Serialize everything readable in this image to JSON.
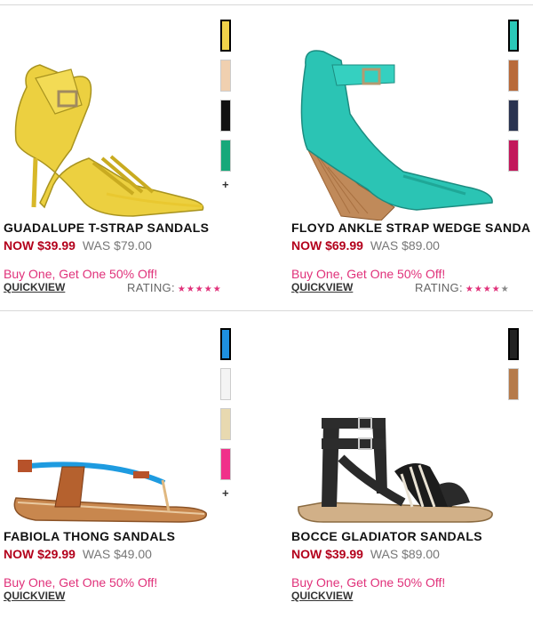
{
  "colors": {
    "price_now": "#b3001b",
    "promo": "#e0317a"
  },
  "products": [
    {
      "name": "GUADALUPE T-STRAP SANDALS",
      "price_now": "NOW $39.99",
      "price_was": "WAS $79.00",
      "promo": "Buy One, Get One 50% Off!",
      "quickview": "QUICKVIEW",
      "rating_label": "RATING:",
      "rating_stars": 5,
      "swatches": [
        "#f0d24a",
        "#f0d0b0",
        "#111111",
        "#17a87a"
      ],
      "more": "+"
    },
    {
      "name": "FLOYD ANKLE STRAP WEDGE SANDA",
      "price_now": "NOW $69.99",
      "price_was": "WAS $89.00",
      "promo": "Buy One, Get One 50% Off!",
      "quickview": "QUICKVIEW",
      "rating_label": "RATING:",
      "rating_stars": 4,
      "swatches": [
        "#2bc9b8",
        "#b86a3a",
        "#2a3350",
        "#c2185b"
      ]
    },
    {
      "name": "FABIOLA THONG SANDALS",
      "price_now": "NOW $29.99",
      "price_was": "WAS $49.00",
      "promo": "Buy One, Get One 50% Off!",
      "quickview": "QUICKVIEW",
      "swatches": [
        "#1e90e0",
        "#f4f4f4",
        "#e8d9b0",
        "#f0308a"
      ],
      "more": "+"
    },
    {
      "name": "BOCCE GLADIATOR SANDALS",
      "price_now": "NOW $39.99",
      "price_was": "WAS $89.00",
      "promo": "Buy One, Get One 50% Off!",
      "quickview": "QUICKVIEW",
      "swatches": [
        "#222222",
        "#b57a4a"
      ]
    }
  ]
}
